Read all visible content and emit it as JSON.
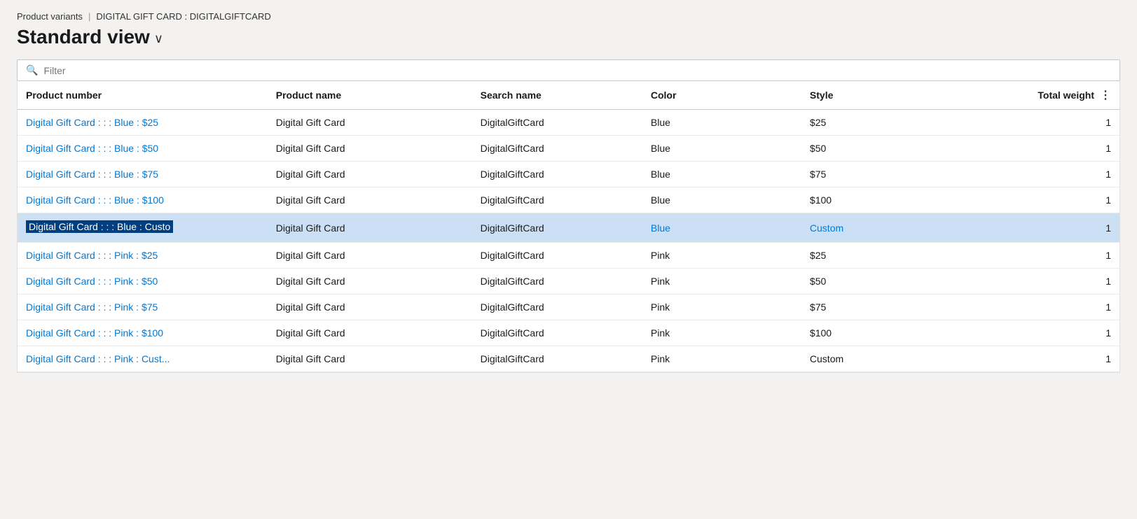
{
  "breadcrumb": {
    "link_label": "Product variants",
    "separator": "|",
    "current": "DIGITAL GIFT CARD : DIGITALGIFTCARD"
  },
  "page_title": "Standard view",
  "chevron": "∨",
  "filter": {
    "placeholder": "Filter"
  },
  "columns": [
    {
      "id": "product-number",
      "label": "Product number"
    },
    {
      "id": "product-name",
      "label": "Product name"
    },
    {
      "id": "search-name",
      "label": "Search name"
    },
    {
      "id": "color",
      "label": "Color"
    },
    {
      "id": "style",
      "label": "Style"
    },
    {
      "id": "total-weight",
      "label": "Total weight"
    },
    {
      "id": "menu",
      "label": "⋮"
    }
  ],
  "rows": [
    {
      "product_number": "Digital Gift Card : : : Blue : $25",
      "product_name": "Digital Gift Card",
      "search_name": "DigitalGiftCard",
      "color": "Blue",
      "style": "$25",
      "total_weight": "1",
      "selected": false
    },
    {
      "product_number": "Digital Gift Card : : : Blue : $50",
      "product_name": "Digital Gift Card",
      "search_name": "DigitalGiftCard",
      "color": "Blue",
      "style": "$50",
      "total_weight": "1",
      "selected": false
    },
    {
      "product_number": "Digital Gift Card : : : Blue : $75",
      "product_name": "Digital Gift Card",
      "search_name": "DigitalGiftCard",
      "color": "Blue",
      "style": "$75",
      "total_weight": "1",
      "selected": false
    },
    {
      "product_number": "Digital Gift Card : : : Blue : $100",
      "product_name": "Digital Gift Card",
      "search_name": "DigitalGiftCard",
      "color": "Blue",
      "style": "$100",
      "total_weight": "1",
      "selected": false
    },
    {
      "product_number": "Digital Gift Card : : : Blue : Custo",
      "product_name": "Digital Gift Card",
      "search_name": "DigitalGiftCard",
      "color": "Blue",
      "style": "Custom",
      "total_weight": "1",
      "selected": true
    },
    {
      "product_number": "Digital Gift Card : : : Pink : $25",
      "product_name": "Digital Gift Card",
      "search_name": "DigitalGiftCard",
      "color": "Pink",
      "style": "$25",
      "total_weight": "1",
      "selected": false
    },
    {
      "product_number": "Digital Gift Card : : : Pink : $50",
      "product_name": "Digital Gift Card",
      "search_name": "DigitalGiftCard",
      "color": "Pink",
      "style": "$50",
      "total_weight": "1",
      "selected": false
    },
    {
      "product_number": "Digital Gift Card : : : Pink : $75",
      "product_name": "Digital Gift Card",
      "search_name": "DigitalGiftCard",
      "color": "Pink",
      "style": "$75",
      "total_weight": "1",
      "selected": false
    },
    {
      "product_number": "Digital Gift Card : : : Pink : $100",
      "product_name": "Digital Gift Card",
      "search_name": "DigitalGiftCard",
      "color": "Pink",
      "style": "$100",
      "total_weight": "1",
      "selected": false
    },
    {
      "product_number": "Digital Gift Card : : : Pink : Cust...",
      "product_name": "Digital Gift Card",
      "search_name": "DigitalGiftCard",
      "color": "Pink",
      "style": "Custom",
      "total_weight": "1",
      "selected": false
    }
  ]
}
